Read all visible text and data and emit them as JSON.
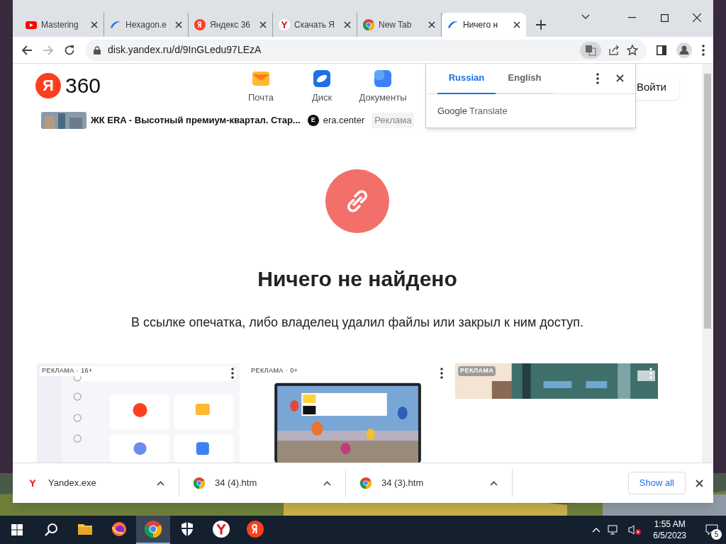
{
  "tabs": [
    {
      "title": "Mastering",
      "kind": "youtube",
      "selected": false
    },
    {
      "title": "Hexagon.e",
      "kind": "disk",
      "selected": false
    },
    {
      "title": "Яндекс 36",
      "kind": "ya",
      "selected": false
    },
    {
      "title": "Скачать Я",
      "kind": "y",
      "selected": false
    },
    {
      "title": "New Tab",
      "kind": "chrome",
      "selected": false
    },
    {
      "title": "Ничего н",
      "kind": "disk",
      "selected": true
    }
  ],
  "address": "disk.yandex.ru/d/9InGLedu97LEzA",
  "translate": {
    "languages": [
      {
        "label": "Russian",
        "selected": true
      },
      {
        "label": "English",
        "selected": false
      }
    ],
    "brand": "Google",
    "product": "Translate"
  },
  "header": {
    "logo_letter": "Я",
    "logo_text": "360",
    "services": [
      {
        "label": "Почта",
        "kind": "mail"
      },
      {
        "label": "Диск",
        "kind": "disk"
      },
      {
        "label": "Документы",
        "kind": "docs"
      }
    ],
    "login": "Войти"
  },
  "ad": {
    "title": "ЖК ERA - Высотный премиум-квартал. Стар...",
    "domain_mark": "E",
    "domain": "era.center",
    "badge": "Реклама"
  },
  "error": {
    "title": "Ничего не найдено",
    "message": "В ссылке опечатка, либо владелец удалил файлы или закрыл к ним доступ."
  },
  "cards": [
    {
      "badge": "РЕКЛАМА · 16+",
      "kind": "browser"
    },
    {
      "badge": "РЕКЛАМА · 0+",
      "kind": "laptop"
    },
    {
      "badge": "РЕКЛАМА",
      "kind": "building"
    }
  ],
  "downloads": {
    "items": [
      {
        "name": "Yandex.exe",
        "kind": "y"
      },
      {
        "name": "34 (4).htm",
        "kind": "chrome"
      },
      {
        "name": "34 (3).htm",
        "kind": "chrome"
      }
    ],
    "show_all": "Show all"
  },
  "taskbar": {
    "apps": [
      {
        "kind": "explorer",
        "selected": false
      },
      {
        "kind": "firefox",
        "selected": false
      },
      {
        "kind": "chrome",
        "selected": true
      },
      {
        "kind": "shield",
        "selected": false
      },
      {
        "kind": "y",
        "selected": false
      },
      {
        "kind": "ya",
        "selected": false
      }
    ],
    "time": "1:55 AM",
    "date": "6/5/2023",
    "notifications": "5"
  }
}
